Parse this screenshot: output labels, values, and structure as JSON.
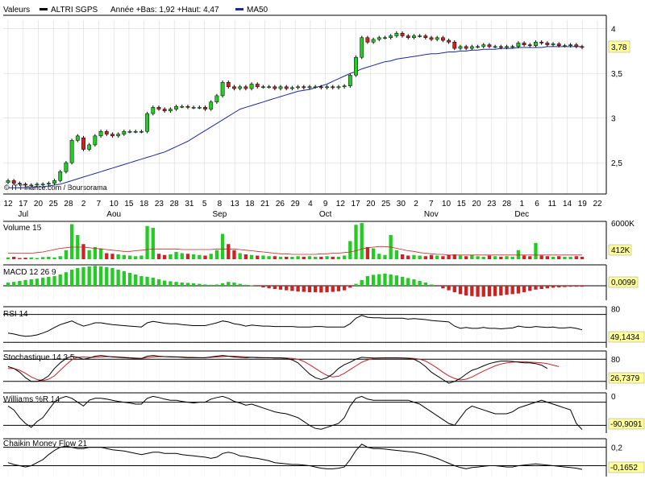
{
  "header": {
    "label": "Valeurs",
    "instrument": "ALTRI SGPS",
    "stats": "Année +Bas: 1,92 +Haut: 4,47",
    "ma_label": "MA50"
  },
  "copyright": "© IT-Finance.com / Boursorama",
  "colors": {
    "up": "#22cc22",
    "down": "#cc2222",
    "ma": "#1a2a99",
    "grid": "#d8d8d8",
    "badge_bg": "#ffff99"
  },
  "panels": {
    "volume": {
      "title": "Volume 15",
      "value": "412K"
    },
    "macd": {
      "title": "MACD 12 26 9",
      "value": "0,0099"
    },
    "rsi": {
      "title": "RSI 14",
      "value": "49,1434"
    },
    "stoch": {
      "title": "Stochastique 14 3 5",
      "value": "26,7379"
    },
    "williams": {
      "title": "Williams %R 14",
      "value": "-90,9091"
    },
    "chaikin": {
      "title": "Chaikin Money Flow 21",
      "value": "-0,1652"
    }
  },
  "chart_data": {
    "type": "candlestick",
    "x_tick_labels": [
      "12",
      "17",
      "20",
      "25",
      "28",
      "2",
      "7",
      "10",
      "15",
      "18",
      "23",
      "28",
      "31",
      "5",
      "8",
      "13",
      "18",
      "21",
      "26",
      "29",
      "4",
      "9",
      "12",
      "17",
      "20",
      "25",
      "30",
      "2",
      "7",
      "10",
      "15",
      "20",
      "23",
      "28",
      "1",
      "6",
      "11",
      "14",
      "19",
      "22"
    ],
    "month_labels": [
      "Jul",
      "Aou",
      "Sep",
      "Oct",
      "Nov",
      "Dec"
    ],
    "price_ticks": [
      "4",
      "3,5",
      "3",
      "2,5"
    ],
    "price_ylim": [
      2.15,
      4.15
    ],
    "last_price": "3,78",
    "volume_ticks": [
      "6000K"
    ],
    "volume_ylim": [
      0,
      6000
    ],
    "oscillator_ticks": {
      "rsi": [
        "80"
      ],
      "stoch": [
        "80"
      ],
      "williams": [
        "0"
      ],
      "chaikin": [
        "0,2"
      ]
    },
    "close": [
      2.3,
      2.27,
      2.26,
      2.25,
      2.25,
      2.26,
      2.26,
      2.27,
      2.3,
      2.4,
      2.5,
      2.75,
      2.8,
      2.65,
      2.7,
      2.8,
      2.85,
      2.82,
      2.8,
      2.82,
      2.85,
      2.85,
      2.85,
      2.85,
      3.05,
      3.12,
      3.1,
      3.08,
      3.1,
      3.13,
      3.13,
      3.12,
      3.12,
      3.12,
      3.1,
      3.18,
      3.25,
      3.4,
      3.35,
      3.33,
      3.35,
      3.33,
      3.38,
      3.35,
      3.35,
      3.35,
      3.33,
      3.35,
      3.33,
      3.34,
      3.35,
      3.34,
      3.35,
      3.35,
      3.34,
      3.35,
      3.34,
      3.35,
      3.36,
      3.48,
      3.68,
      3.9,
      3.85,
      3.88,
      3.9,
      3.9,
      3.92,
      3.95,
      3.92,
      3.9,
      3.92,
      3.92,
      3.9,
      3.88,
      3.9,
      3.87,
      3.85,
      3.78,
      3.8,
      3.78,
      3.8,
      3.8,
      3.82,
      3.8,
      3.8,
      3.79,
      3.8,
      3.8,
      3.84,
      3.82,
      3.81,
      3.85,
      3.84,
      3.82,
      3.83,
      3.81,
      3.81,
      3.82,
      3.8,
      3.79
    ],
    "open": [
      2.28,
      2.3,
      2.27,
      2.26,
      2.25,
      2.25,
      2.26,
      2.26,
      2.27,
      2.3,
      2.4,
      2.5,
      2.75,
      2.78,
      2.65,
      2.7,
      2.8,
      2.85,
      2.82,
      2.8,
      2.82,
      2.85,
      2.85,
      2.85,
      2.85,
      3.05,
      3.12,
      3.1,
      3.08,
      3.1,
      3.13,
      3.13,
      3.12,
      3.12,
      3.12,
      3.1,
      3.18,
      3.25,
      3.4,
      3.35,
      3.33,
      3.35,
      3.33,
      3.38,
      3.35,
      3.35,
      3.35,
      3.33,
      3.35,
      3.33,
      3.34,
      3.35,
      3.34,
      3.35,
      3.35,
      3.34,
      3.35,
      3.34,
      3.35,
      3.36,
      3.48,
      3.68,
      3.9,
      3.85,
      3.88,
      3.9,
      3.9,
      3.92,
      3.95,
      3.92,
      3.9,
      3.92,
      3.92,
      3.9,
      3.88,
      3.9,
      3.87,
      3.85,
      3.78,
      3.8,
      3.78,
      3.8,
      3.8,
      3.82,
      3.8,
      3.8,
      3.79,
      3.8,
      3.8,
      3.84,
      3.82,
      3.81,
      3.85,
      3.84,
      3.82,
      3.83,
      3.81,
      3.81,
      3.82,
      3.8
    ],
    "ma50": [
      2.22,
      2.22,
      2.22,
      2.22,
      2.22,
      2.23,
      2.23,
      2.24,
      2.25,
      2.26,
      2.28,
      2.3,
      2.32,
      2.34,
      2.36,
      2.38,
      2.4,
      2.42,
      2.44,
      2.46,
      2.48,
      2.5,
      2.52,
      2.54,
      2.56,
      2.58,
      2.6,
      2.62,
      2.65,
      2.68,
      2.71,
      2.74,
      2.78,
      2.82,
      2.86,
      2.9,
      2.94,
      2.98,
      3.02,
      3.06,
      3.1,
      3.12,
      3.14,
      3.16,
      3.18,
      3.2,
      3.22,
      3.24,
      3.26,
      3.28,
      3.3,
      3.31,
      3.32,
      3.34,
      3.36,
      3.38,
      3.41,
      3.44,
      3.47,
      3.5,
      3.52,
      3.55,
      3.57,
      3.59,
      3.61,
      3.63,
      3.64,
      3.66,
      3.67,
      3.68,
      3.69,
      3.7,
      3.71,
      3.72,
      3.72,
      3.73,
      3.74,
      3.74,
      3.75,
      3.75,
      3.76,
      3.76,
      3.77,
      3.77,
      3.77,
      3.78,
      3.78,
      3.78,
      3.79,
      3.79,
      3.79,
      3.79,
      3.79,
      3.8,
      3.8,
      3.8,
      3.8,
      3.8,
      3.8,
      3.8
    ],
    "volume": [
      300,
      400,
      200,
      250,
      300,
      200,
      350,
      400,
      300,
      500,
      1500,
      5800,
      4000,
      2500,
      1500,
      2000,
      1800,
      1000,
      900,
      800,
      700,
      600,
      500,
      600,
      5500,
      5200,
      900,
      700,
      800,
      1200,
      1000,
      900,
      800,
      700,
      600,
      900,
      1500,
      4200,
      2500,
      1500,
      1000,
      800,
      700,
      600,
      600,
      500,
      500,
      400,
      400,
      400,
      500,
      400,
      500,
      400,
      400,
      500,
      400,
      400,
      600,
      3000,
      5700,
      6000,
      2000,
      1800,
      900,
      700,
      4000,
      1500,
      800,
      600,
      700,
      600,
      500,
      700,
      600,
      500,
      700,
      800,
      600,
      500,
      700,
      500,
      400,
      600,
      500,
      400,
      500,
      400,
      1500,
      600,
      500,
      2700,
      600,
      500,
      400,
      500,
      400,
      400,
      500,
      400
    ],
    "volume_ma": [
      1000,
      1000,
      1000,
      1000,
      1000,
      1100,
      1200,
      1400,
      1600,
      1800,
      1900,
      2000,
      2000,
      2000,
      1900,
      1800,
      1700,
      1600,
      1500,
      1400,
      1300,
      1300,
      1400,
      1500,
      1600,
      1700,
      1700,
      1700,
      1700,
      1700,
      1600,
      1600,
      1600,
      1600,
      1600,
      1600,
      1700,
      1700,
      1700,
      1700,
      1600,
      1500,
      1400,
      1300,
      1200,
      1100,
      1000,
      900,
      900,
      800,
      800,
      800,
      800,
      800,
      900,
      900,
      1000,
      1000,
      1100,
      1200,
      1400,
      1700,
      1900,
      2000,
      2100,
      2100,
      2000,
      1800,
      1600,
      1400,
      1300,
      1100,
      1000,
      900,
      800,
      800,
      700,
      700,
      700,
      700,
      700,
      700,
      700,
      700,
      700,
      700,
      700,
      700,
      700,
      700,
      700,
      700,
      700,
      700,
      700,
      700,
      700,
      700,
      700,
      700
    ],
    "macd": [
      0.01,
      0.012,
      0.015,
      0.018,
      0.02,
      0.022,
      0.025,
      0.028,
      0.03,
      0.035,
      0.042,
      0.05,
      0.055,
      0.058,
      0.06,
      0.062,
      0.06,
      0.058,
      0.055,
      0.05,
      0.045,
      0.04,
      0.035,
      0.03,
      0.028,
      0.025,
      0.02,
      0.016,
      0.014,
      0.012,
      0.01,
      0.009,
      0.008,
      0.006,
      0.004,
      0.003,
      0.004,
      0.008,
      0.012,
      0.01,
      0.006,
      0.003,
      0.001,
      -0.002,
      -0.005,
      -0.008,
      -0.01,
      -0.012,
      -0.014,
      -0.016,
      -0.018,
      -0.019,
      -0.02,
      -0.02,
      -0.021,
      -0.02,
      -0.019,
      -0.017,
      -0.014,
      -0.006,
      0.006,
      0.018,
      0.03,
      0.034,
      0.036,
      0.038,
      0.035,
      0.032,
      0.028,
      0.024,
      0.02,
      0.015,
      0.01,
      0.004,
      -0.002,
      -0.008,
      -0.014,
      -0.02,
      -0.026,
      -0.03,
      -0.032,
      -0.034,
      -0.034,
      -0.033,
      -0.032,
      -0.03,
      -0.028,
      -0.026,
      -0.024,
      -0.02,
      -0.016,
      -0.012,
      -0.01,
      -0.008,
      -0.006,
      -0.005,
      -0.004,
      -0.003,
      -0.003,
      -0.003
    ],
    "rsi": [
      40,
      38,
      35,
      33,
      34,
      36,
      40,
      45,
      52,
      58,
      62,
      66,
      60,
      55,
      58,
      62,
      62,
      60,
      58,
      57,
      56,
      55,
      54,
      53,
      62,
      65,
      63,
      61,
      60,
      60,
      58,
      57,
      56,
      56,
      56,
      59,
      62,
      66,
      64,
      60,
      58,
      55,
      57,
      56,
      55,
      55,
      54,
      54,
      54,
      54,
      53,
      53,
      53,
      54,
      54,
      53,
      53,
      53,
      53,
      60,
      72,
      78,
      74,
      73,
      73,
      72,
      72,
      72,
      72,
      70,
      71,
      70,
      69,
      67,
      66,
      65,
      64,
      55,
      50,
      52,
      50,
      50,
      52,
      50,
      50,
      49,
      50,
      51,
      55,
      53,
      52,
      54,
      53,
      52,
      53,
      51,
      51,
      52,
      50,
      47
    ],
    "stoch_k": [
      60,
      55,
      45,
      30,
      20,
      20,
      25,
      35,
      55,
      70,
      82,
      88,
      85,
      80,
      83,
      88,
      90,
      88,
      86,
      85,
      84,
      83,
      82,
      82,
      88,
      90,
      88,
      87,
      86,
      86,
      85,
      84,
      84,
      84,
      84,
      86,
      88,
      90,
      88,
      86,
      85,
      84,
      85,
      84,
      84,
      84,
      83,
      83,
      82,
      78,
      70,
      55,
      40,
      30,
      25,
      30,
      40,
      55,
      65,
      72,
      80,
      85,
      84,
      83,
      83,
      83,
      83,
      83,
      83,
      82,
      80,
      72,
      60,
      45,
      35,
      25,
      15,
      20,
      28,
      40,
      50,
      55,
      62,
      68,
      72,
      75,
      75,
      74,
      72,
      70,
      70,
      68,
      64,
      55
    ],
    "stoch_d": [
      55,
      55,
      50,
      42,
      32,
      25,
      22,
      26,
      35,
      50,
      65,
      78,
      85,
      86,
      85,
      85,
      86,
      87,
      87,
      86,
      85,
      84,
      83,
      82,
      84,
      86,
      87,
      87,
      87,
      86,
      86,
      85,
      85,
      84,
      84,
      85,
      86,
      87,
      88,
      88,
      87,
      86,
      85,
      85,
      84,
      84,
      84,
      84,
      83,
      82,
      80,
      74,
      65,
      55,
      45,
      36,
      32,
      34,
      42,
      52,
      62,
      72,
      78,
      82,
      83,
      84,
      84,
      84,
      83,
      83,
      82,
      80,
      75,
      66,
      56,
      45,
      35,
      28,
      24,
      26,
      32,
      40,
      48,
      55,
      62,
      67,
      70,
      72,
      73,
      73,
      72,
      71,
      70,
      68,
      64,
      60
    ],
    "williams": [
      -30,
      -40,
      -60,
      -75,
      -85,
      -70,
      -60,
      -40,
      -20,
      -10,
      -5,
      -10,
      -20,
      -30,
      -15,
      -10,
      -10,
      -12,
      -15,
      -18,
      -20,
      -22,
      -25,
      -25,
      -10,
      -5,
      -8,
      -12,
      -15,
      -15,
      -18,
      -20,
      -22,
      -20,
      -20,
      -12,
      -8,
      -5,
      -10,
      -18,
      -22,
      -28,
      -25,
      -30,
      -35,
      -40,
      -45,
      -48,
      -50,
      -55,
      -60,
      -70,
      -80,
      -88,
      -90,
      -85,
      -80,
      -75,
      -60,
      -30,
      -10,
      -5,
      -12,
      -15,
      -15,
      -15,
      -15,
      -15,
      -15,
      -15,
      -20,
      -25,
      -35,
      -45,
      -55,
      -65,
      -75,
      -80,
      -60,
      -40,
      -30,
      -35,
      -40,
      -45,
      -50,
      -50,
      -50,
      -45,
      -35,
      -30,
      -25,
      -20,
      -15,
      -20,
      -25,
      -30,
      -35,
      -40,
      -75,
      -91
    ],
    "chaikin": [
      -0.05,
      -0.08,
      -0.1,
      -0.12,
      -0.1,
      -0.05,
      0.0,
      0.08,
      0.15,
      0.2,
      0.22,
      0.2,
      0.18,
      0.18,
      0.2,
      0.2,
      0.2,
      0.18,
      0.16,
      0.15,
      0.14,
      0.12,
      0.1,
      0.08,
      0.1,
      0.12,
      0.12,
      0.1,
      0.1,
      0.1,
      0.08,
      0.07,
      0.06,
      0.05,
      0.04,
      0.02,
      0.04,
      0.1,
      0.12,
      0.1,
      0.06,
      0.05,
      0.03,
      0.02,
      0.0,
      -0.02,
      -0.05,
      -0.06,
      -0.07,
      -0.08,
      -0.08,
      -0.09,
      -0.1,
      -0.12,
      -0.14,
      -0.15,
      -0.15,
      -0.14,
      -0.12,
      0.0,
      0.15,
      0.25,
      0.2,
      0.18,
      0.18,
      0.17,
      0.16,
      0.15,
      0.14,
      0.13,
      0.12,
      0.1,
      0.08,
      0.05,
      0.02,
      -0.02,
      -0.06,
      -0.1,
      -0.13,
      -0.15,
      -0.13,
      -0.12,
      -0.11,
      -0.1,
      -0.1,
      -0.11,
      -0.12,
      -0.12,
      -0.1,
      -0.09,
      -0.08,
      -0.07,
      -0.08,
      -0.09,
      -0.1,
      -0.11,
      -0.12,
      -0.13,
      -0.14,
      -0.16
    ]
  }
}
